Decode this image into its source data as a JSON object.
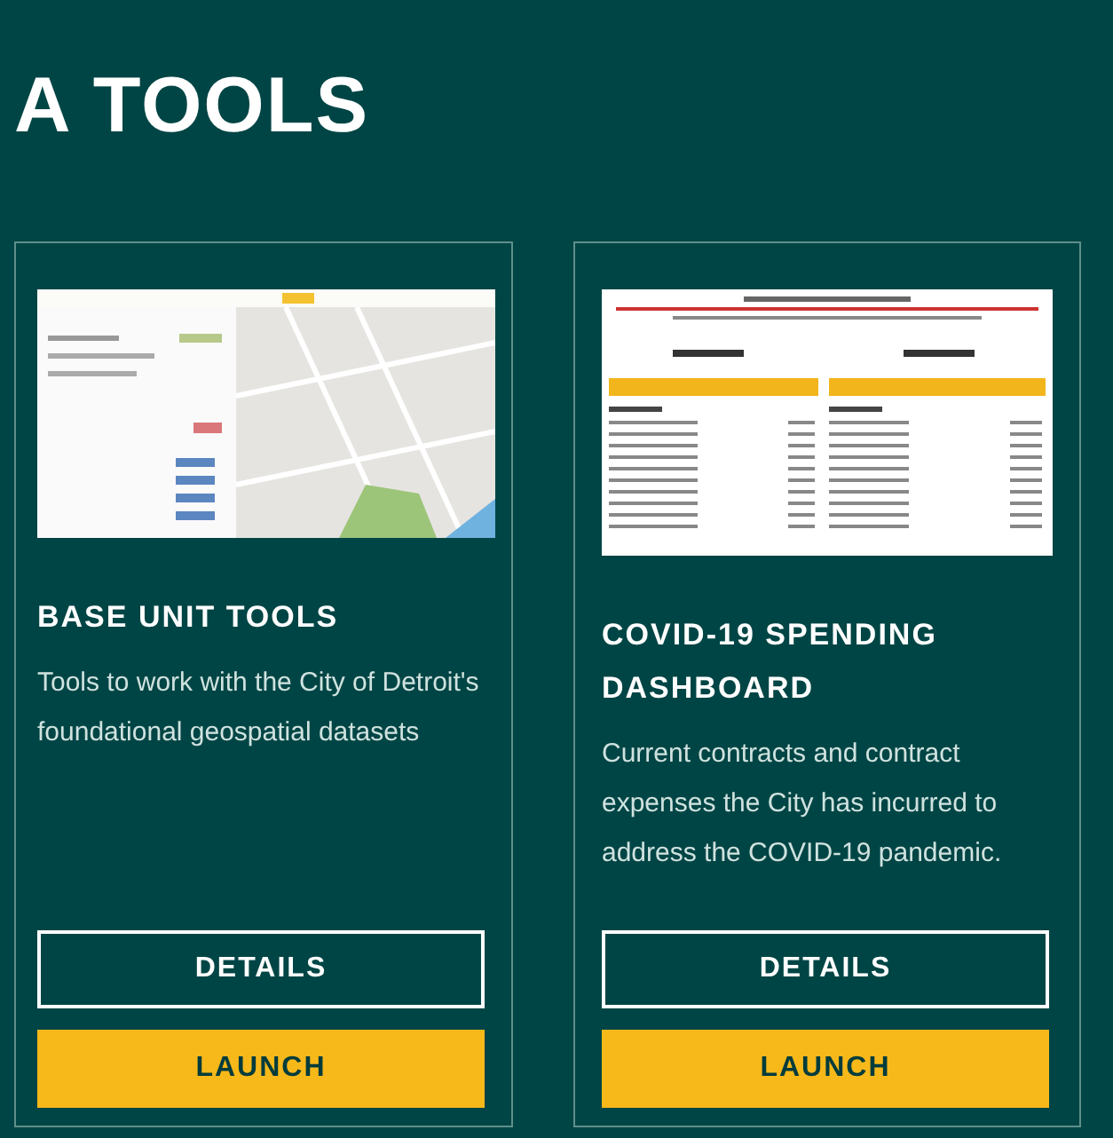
{
  "heading": "A TOOLS",
  "cards": [
    {
      "thumbnail": {
        "kind": "map"
      },
      "title": "BASE UNIT TOOLS",
      "description": "Tools to work with the City of Detroit's foundational geospatial datasets",
      "buttons": [
        {
          "label": "DETAILS",
          "kind": "outline"
        },
        {
          "label": "LAUNCH",
          "kind": "primary"
        }
      ]
    },
    {
      "thumbnail": {
        "kind": "dashboard"
      },
      "title": "COVID-19 SPENDING DASHBOARD",
      "description": "Current contracts and contract expenses the City has incurred to address the COVID-19 pandemic.",
      "buttons": [
        {
          "label": "DETAILS",
          "kind": "outline"
        },
        {
          "label": "LAUNCH",
          "kind": "primary"
        }
      ]
    }
  ]
}
